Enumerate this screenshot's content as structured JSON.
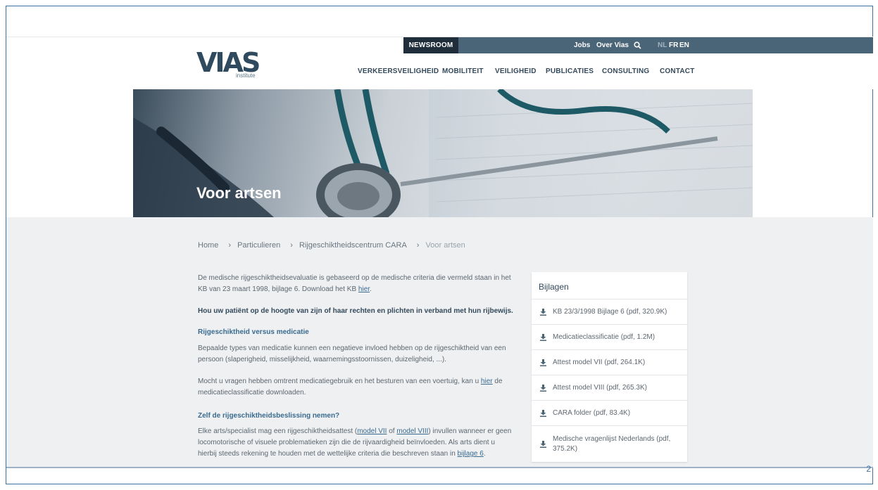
{
  "header": {
    "newsroom": "NEWSROOM",
    "util_links": [
      "Jobs",
      "Over Vias"
    ],
    "languages": [
      "NL",
      "FR",
      "EN"
    ],
    "logo": "VIAS",
    "logo_sub": "institute",
    "nav": [
      "VERKEERSVEILIGHEID",
      "MOBILITEIT",
      "VEILIGHEID",
      "PUBLICATIES",
      "CONSULTING",
      "CONTACT"
    ]
  },
  "hero": {
    "title": "Voor artsen"
  },
  "breadcrumb": [
    "Home",
    "Particulieren",
    "Rijgeschiktheidscentrum CARA",
    "Voor artsen"
  ],
  "main": {
    "intro_a": "De medische rijgeschiktheidsevaluatie is gebaseerd op de medische criteria die vermeld staan in het KB van 23 maart 1998, bijlage 6. Download het KB ",
    "intro_link": "hier",
    "intro_b": ".",
    "bold_line": "Hou uw patiënt op de hoogte van zijn of haar rechten en plichten in verband met hun rijbewijs.",
    "sub1": "Rijgeschiktheid versus medicatie",
    "p1": "Bepaalde types van medicatie kunnen een negatieve invloed hebben op de rijgeschiktheid van een persoon (slaperigheid, misselijkheid, waarnemingsstoornissen, duizeligheid, ...).",
    "p2_a": "Mocht u vragen hebben omtrent medicatiegebruik en het besturen van een voertuig, kan u ",
    "p2_link": "hier",
    "p2_b": " de medicatieclassificatie downloaden.",
    "sub2": "Zelf de rijgeschiktheidsbeslissing nemen?",
    "p3_a": "Elke arts/specialist mag een rijgeschiktheidsattest (",
    "p3_link1": "model VII",
    "p3_of": " of ",
    "p3_link2": "model VIII",
    "p3_b": ") invullen wanneer er geen locomotorische of visuele problematieken zijn die de rijvaardigheid beïnvloeden. Als arts dient u hierbij steeds rekening te houden met de wettelijke criteria die beschreven staan in ",
    "p3_link3": "bijlage 6",
    "p3_c": "."
  },
  "sidebar": {
    "title": "Bijlagen",
    "items": [
      "KB 23/3/1998 Bijlage 6 (pdf, 320.9K)",
      "Medicatieclassificatie (pdf, 1.2M)",
      "Attest model VII (pdf, 264.1K)",
      "Attest model VIII (pdf, 265.3K)",
      "CARA folder (pdf, 83.4K)",
      "Medische vragenlijst Nederlands (pdf, 375.2K)"
    ]
  },
  "page_number": "2",
  "colors": {
    "header_bar": "#4b6578",
    "newsroom": "#1f2e3a",
    "accent": "#3a6b8f"
  }
}
